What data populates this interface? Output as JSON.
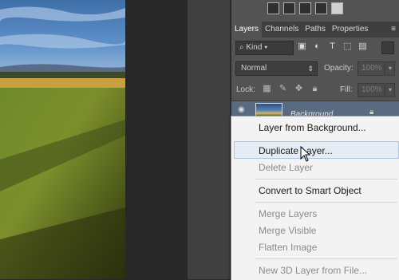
{
  "tabs": {
    "layers": "Layers",
    "channels": "Channels",
    "paths": "Paths",
    "properties": "Properties"
  },
  "filter": {
    "kind_label": "Kind"
  },
  "blend": {
    "mode": "Normal",
    "opacity_label": "Opacity:",
    "opacity_value": "100%"
  },
  "lock": {
    "lock_label": "Lock:",
    "fill_label": "Fill:",
    "fill_value": "100%"
  },
  "layer": {
    "name": "Background"
  },
  "context_menu": {
    "items": [
      {
        "label": "Layer from Background...",
        "enabled": true
      },
      {
        "label": "Duplicate Layer...",
        "enabled": true,
        "hovered": true
      },
      {
        "label": "Delete Layer",
        "enabled": false
      },
      {
        "label": "Convert to Smart Object",
        "enabled": true
      },
      {
        "label": "Merge Layers",
        "enabled": false
      },
      {
        "label": "Merge Visible",
        "enabled": false
      },
      {
        "label": "Flatten Image",
        "enabled": false
      },
      {
        "label": "New 3D Layer from File...",
        "enabled": false
      }
    ]
  },
  "colors": {
    "panel_bg": "#535353",
    "tab_bar": "#3f3f3f",
    "selected_layer": "#5a6a80",
    "menu_bg": "#f3f3f3",
    "menu_highlight": "#e4ecf5"
  }
}
